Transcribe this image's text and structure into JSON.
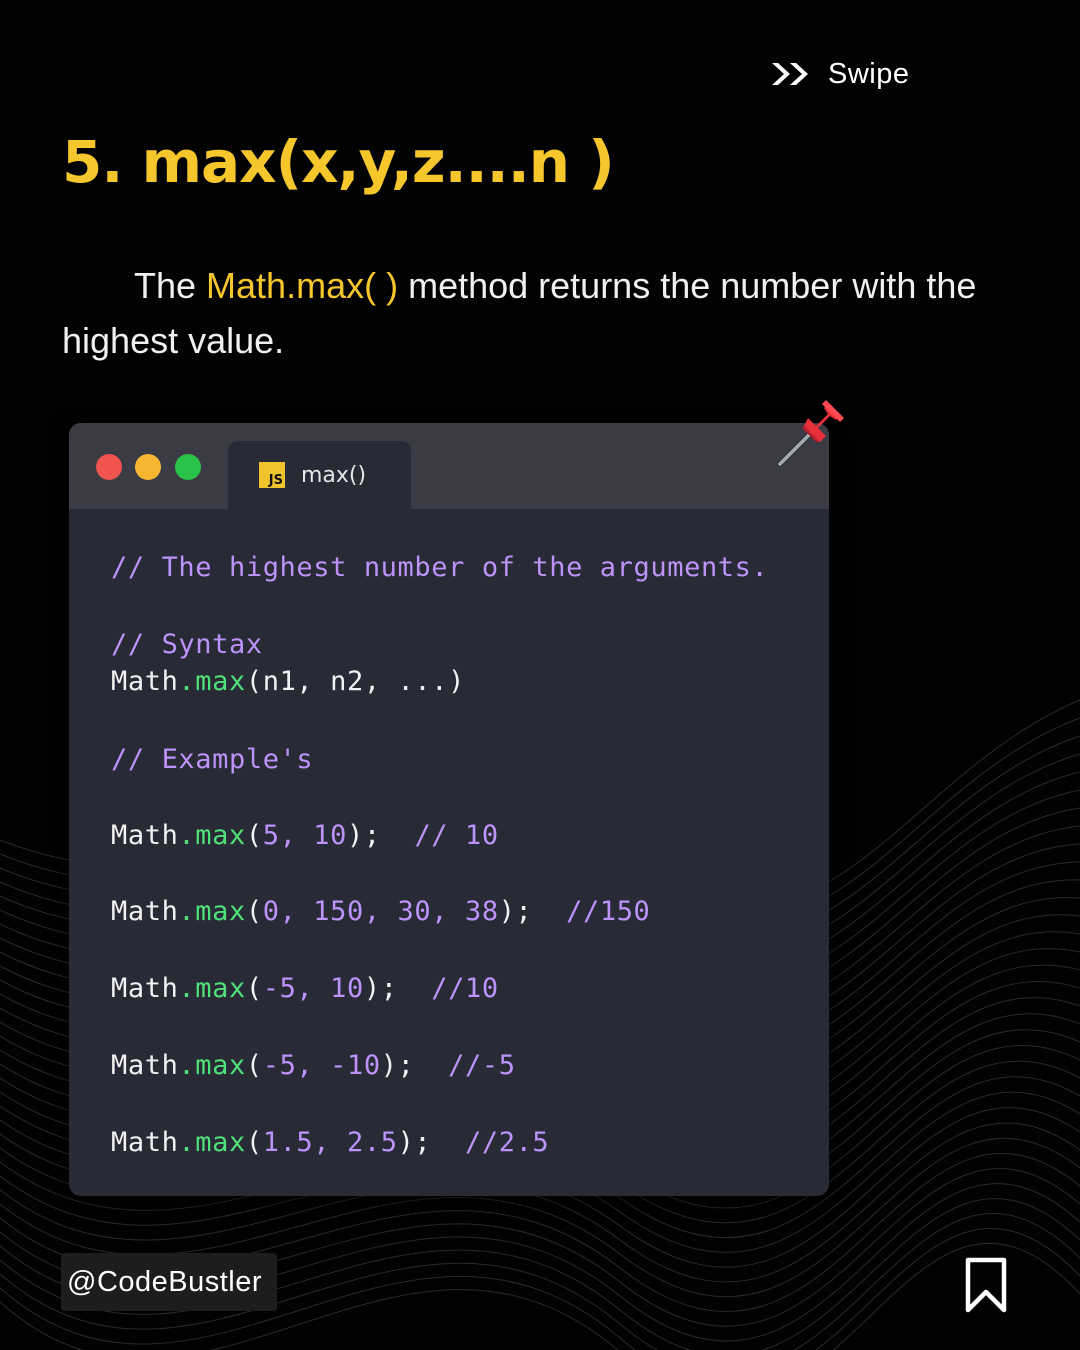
{
  "header": {
    "swipe_icon": "double-chevron-right-icon",
    "swipe_label": "Swipe"
  },
  "title": "5. max(x,y,z....n )",
  "description": {
    "prefix": "The ",
    "highlight": "Math.max( )",
    "suffix": " method returns the number with the highest value."
  },
  "window": {
    "controls": [
      "close-dot",
      "minimize-dot",
      "maximize-dot"
    ],
    "tab": {
      "icon_text": "JS",
      "label": "max()"
    }
  },
  "code_lines": [
    {
      "comment": "// The highest number of the arguments."
    },
    {
      "comment": "// Syntax"
    },
    {
      "obj": "Math",
      "dot": ".",
      "method": "max",
      "args": "(n1, n2, ...)"
    },
    {
      "comment": "// Example's"
    },
    {
      "obj": "Math",
      "dot": ".",
      "method": "max",
      "open": "(",
      "args": "5, 10",
      "close": ");",
      "comment": "// 10"
    },
    {
      "obj": "Math",
      "dot": ".",
      "method": "max",
      "open": "(",
      "args": "0, 150, 30, 38",
      "close": ");",
      "comment": "//150"
    },
    {
      "obj": "Math",
      "dot": ".",
      "method": "max",
      "open": "(",
      "args": "-5, 10",
      "close": ");",
      "comment": "//10"
    },
    {
      "obj": "Math",
      "dot": ".",
      "method": "max",
      "open": "(",
      "args": "-5, -10",
      "close": ");",
      "comment": "//-5"
    },
    {
      "obj": "Math",
      "dot": ".",
      "method": "max",
      "open": "(",
      "args": "1.5, 2.5",
      "close": ");",
      "comment": "//2.5"
    }
  ],
  "decor": {
    "pin_icon": "pushpin-icon"
  },
  "footer": {
    "handle": "@CodeBustler",
    "bookmark_icon": "bookmark-icon"
  },
  "colors": {
    "accent": "#f6c62d",
    "background": "#020203",
    "code_bg": "#282a36",
    "titlebar": "#3a3b45",
    "comment": "#bd93f9",
    "method": "#50e07a"
  }
}
